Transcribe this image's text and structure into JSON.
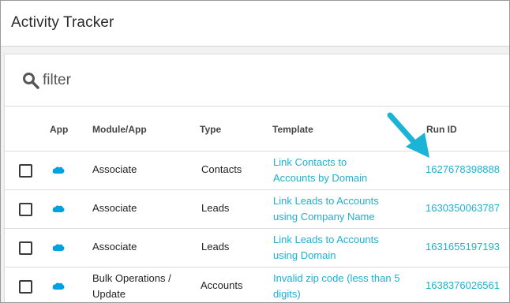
{
  "app": {
    "title": "Activity Tracker"
  },
  "filter": {
    "placeholder": "filter",
    "value": ""
  },
  "columns": {
    "app": "App",
    "module": "Module/App",
    "type": "Type",
    "template": "Template",
    "run_id": "Run ID"
  },
  "rows": [
    {
      "module_line1": "Associate",
      "module_line2": "",
      "type": "Contacts",
      "template_line1": "Link Contacts to",
      "template_line2": "Accounts by Domain",
      "run_id": "1627678398888"
    },
    {
      "module_line1": "Associate",
      "module_line2": "",
      "type": "Leads",
      "template_line1": "Link Leads to Accounts",
      "template_line2": "using Company Name",
      "run_id": "1630350063787"
    },
    {
      "module_line1": "Associate",
      "module_line2": "",
      "type": "Leads",
      "template_line1": "Link Leads to Accounts",
      "template_line2": "using Domain",
      "run_id": "1631655197193"
    },
    {
      "module_line1": "Bulk Operations /",
      "module_line2": "Update",
      "type": "Accounts",
      "template_line1": "Invalid zip code (less than 5",
      "template_line2": "digits)",
      "run_id": "1638376026561"
    }
  ],
  "icons": {
    "search": "search-icon",
    "app": "salesforce-cloud-icon",
    "annotation": "arrow-annotation"
  },
  "colors": {
    "link": "#1eb0cf",
    "cloud": "#00a1e0",
    "arrow": "#1bb4d6"
  }
}
